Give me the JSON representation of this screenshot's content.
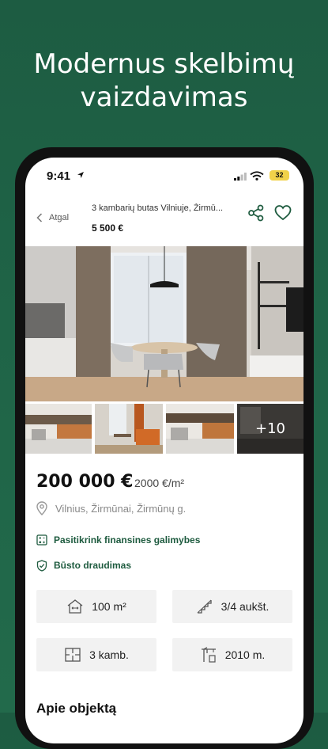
{
  "promo": {
    "headline_line1": "Modernus skelbimų",
    "headline_line2": "vaizdavimas"
  },
  "status_bar": {
    "time": "9:41",
    "battery": "32"
  },
  "nav": {
    "back_label": "Atgal",
    "title": "3 kambarių butas Vilniuje, Žirmū...",
    "price": "5 500 €"
  },
  "gallery": {
    "more_label": "+10"
  },
  "listing": {
    "price": "200 000 €",
    "price_per_m2": "2000 €/m²",
    "address": "Vilnius, Žirmūnai, Žirmūnų g.",
    "finance_link": "Pasitikrink finansines galimybes",
    "insurance_link": "Būsto draudimas"
  },
  "features": [
    {
      "icon": "area-icon",
      "value": "100 m²"
    },
    {
      "icon": "stairs-icon",
      "value": "3/4 aukšt."
    },
    {
      "icon": "floorplan-icon",
      "value": "3 kamb."
    },
    {
      "icon": "crane-icon",
      "value": "2010 m."
    }
  ],
  "sections": {
    "about_title": "Apie objektą"
  },
  "colors": {
    "brand_green": "#1f6447",
    "link_green": "#1e5b3f",
    "battery_yellow": "#f1d24a"
  }
}
